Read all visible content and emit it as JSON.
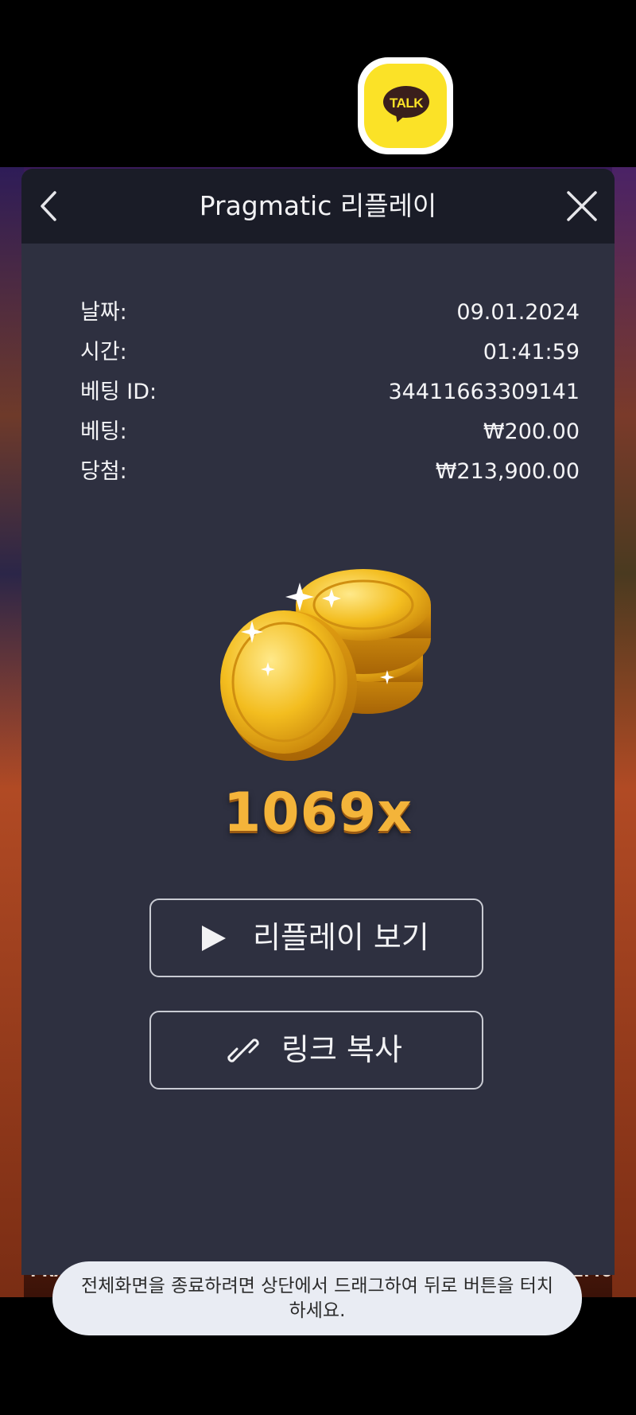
{
  "kakao": {
    "badge_text": "TALK",
    "bg_color": "#fbe227"
  },
  "game": {
    "footer_left": "PRA",
    "footer_right": "1:46"
  },
  "panel": {
    "title": "Pragmatic 리플레이",
    "back_icon": "chevron-left-icon",
    "close_icon": "close-icon"
  },
  "details": [
    {
      "label": "날짜:",
      "value": "09.01.2024"
    },
    {
      "label": "시간:",
      "value": "01:41:59"
    },
    {
      "label": "베팅 ID:",
      "value": "34411663309141"
    },
    {
      "label": "베팅:",
      "value": "₩200.00"
    },
    {
      "label": "당첨:",
      "value": "₩213,900.00"
    }
  ],
  "win": {
    "multiplier": "1069x",
    "icon": "gold-coins-icon"
  },
  "buttons": {
    "replay_label": "리플레이 보기",
    "replay_icon": "play-icon",
    "copy_label": "링크 복사",
    "copy_icon": "link-icon"
  },
  "toast": {
    "message": "전체화면을 종료하려면 상단에서 드래그하여 뒤로 버튼을 터치하세요."
  },
  "colors": {
    "panel_bg": "#2e3040",
    "header_bg": "#1a1c27",
    "accent_gold": "#f4b43a"
  }
}
